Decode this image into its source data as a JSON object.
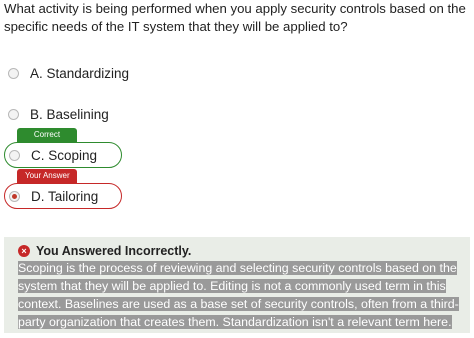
{
  "question": {
    "text": "What activity is being performed when you apply security controls based on the specific needs of the IT system that they will be applied to?"
  },
  "options": [
    {
      "label": "A. Standardizing"
    },
    {
      "label": "B. Baselining"
    },
    {
      "label": "C. Scoping",
      "tag": "Correct"
    },
    {
      "label": "D. Tailoring",
      "tag": "Your Answer"
    }
  ],
  "feedback": {
    "title": "You Answered Incorrectly.",
    "body": "Scoping is the process of reviewing and selecting security controls based on the system that they will be applied to. Editing is not a commonly used term in this context. Baselines are used as a base set of security controls, often from a third-party organization that creates them. Standardization isn't a relevant term here."
  },
  "colors": {
    "correct": "#2e8b2e",
    "incorrect": "#c62828",
    "feedback_bg": "#e9ede7",
    "highlight": "#9a9a9a"
  },
  "icons": {
    "feedback": "x-circle-icon",
    "radio": "radio-icon"
  }
}
